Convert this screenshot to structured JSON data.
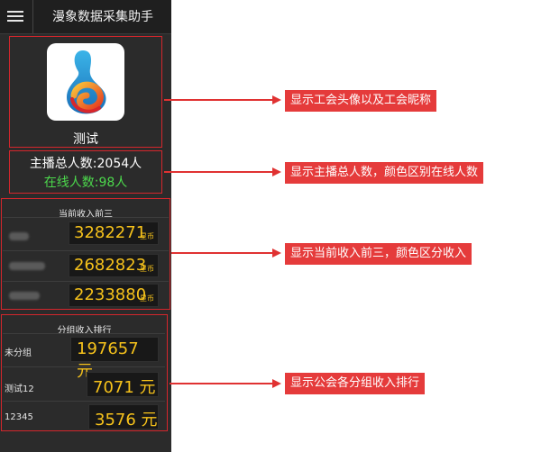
{
  "app": {
    "title": "漫象数据采集助手",
    "menu_icon": "menu-icon"
  },
  "profile": {
    "nickname": "测试",
    "avatar_icon": "union-logo-icon"
  },
  "stats": {
    "total_text": "主播总人数:2054人",
    "online_text": "在线人数:98人",
    "online_color": "#4cd84c"
  },
  "top_income": {
    "heading": "当前收入前三",
    "unit": "星币",
    "rows": [
      {
        "value": "3282271"
      },
      {
        "value": "2682823"
      },
      {
        "value": "2233880"
      }
    ]
  },
  "group_income": {
    "heading": "分组收入排行",
    "rows": [
      {
        "name": "未分组",
        "value": "197657 元"
      },
      {
        "name": "测试12",
        "value": "7071 元"
      },
      {
        "name": "12345",
        "value": "3576 元"
      }
    ]
  },
  "annotations": [
    {
      "text": "显示工会头像以及工会昵称"
    },
    {
      "text": "显示主播总人数，颜色区别在线人数"
    },
    {
      "text": "显示当前收入前三，颜色区分收入"
    },
    {
      "text": "显示公会各分组收入排行"
    }
  ],
  "colors": {
    "accent_red": "#e53b3b",
    "income_yellow": "#f6c21b",
    "panel_bg": "#2b2b2b"
  }
}
